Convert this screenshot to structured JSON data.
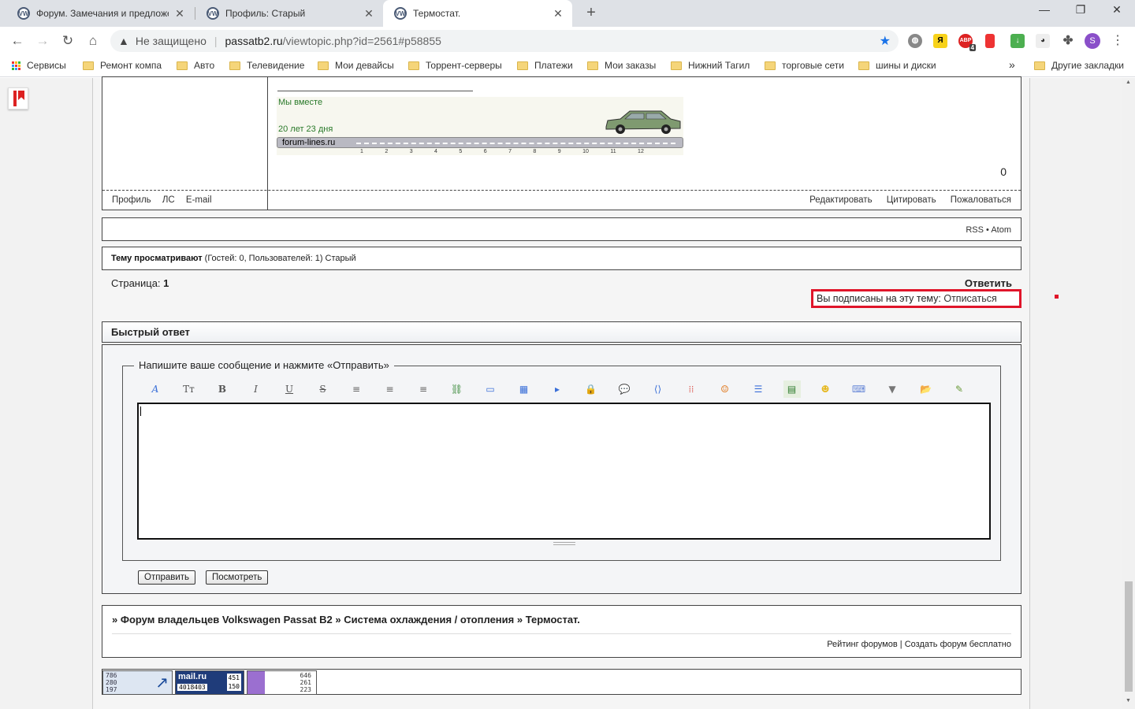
{
  "browser": {
    "tabs": [
      {
        "title": "Форум. Замечания и предложен"
      },
      {
        "title": "Профиль: Старый"
      },
      {
        "title": "Термостат."
      }
    ],
    "new_tab": "+",
    "window": {
      "minimize": "—",
      "maximize": "❐",
      "close": "✕"
    },
    "omnibox": {
      "security": "Не защищено",
      "url_host": "passatb2.ru",
      "url_path": "/viewtopic.php?id=2561#p58855"
    },
    "ext_badge": "4",
    "avatar_letter": "S",
    "bookmarks": [
      "Сервисы",
      "Ремонт компа",
      "Авто",
      "Телевидение",
      "Мои девайсы",
      "Торрент-серверы",
      "Платежи",
      "Мои заказы",
      "Нижний Тагил",
      "торговые сети",
      "шины и диски"
    ],
    "bookmarks_more": "»",
    "other_bookmarks": "Другие закладки"
  },
  "post": {
    "signature": {
      "together_label": "Мы вместе",
      "duration": "20 лет   23 дня",
      "site": "forum-lines.ru",
      "ruler": [
        "1",
        "2",
        "3",
        "4",
        "5",
        "6",
        "7",
        "8",
        "9",
        "10",
        "11",
        "12"
      ]
    },
    "count": "0",
    "user_links": [
      "Профиль",
      "ЛС",
      "E-mail"
    ],
    "actions": [
      "Редактировать",
      "Цитировать",
      "Пожаловаться"
    ]
  },
  "feeds": {
    "rss": "RSS",
    "bullet": "•",
    "atom": "Atom"
  },
  "viewers": {
    "label": "Тему просматривают",
    "detail": "(Гостей: 0, Пользователей: 1)",
    "user": "Старый"
  },
  "pager": {
    "label": "Страница:",
    "current": "1"
  },
  "reply_link": "Ответить",
  "subscription": {
    "text": "Вы подписаны на эту тему:",
    "action": "Отписаться"
  },
  "quick_reply": {
    "title": "Быстрый ответ",
    "legend": "Напишите ваше сообщение и нажмите «Отправить»",
    "tools": [
      {
        "icon": "font-color-icon",
        "glyph": "A"
      },
      {
        "icon": "font-size-icon",
        "glyph": "Tт"
      },
      {
        "icon": "bold-icon",
        "glyph": "B"
      },
      {
        "icon": "italic-icon",
        "glyph": "I"
      },
      {
        "icon": "underline-icon",
        "glyph": "U"
      },
      {
        "icon": "strikethrough-icon",
        "glyph": "S"
      },
      {
        "icon": "align-left-icon",
        "glyph": "≡"
      },
      {
        "icon": "align-center-icon",
        "glyph": "≡"
      },
      {
        "icon": "align-right-icon",
        "glyph": "≡"
      },
      {
        "icon": "link-icon",
        "glyph": "⛓"
      },
      {
        "icon": "image-icon",
        "glyph": "▭"
      },
      {
        "icon": "gallery-icon",
        "glyph": "▦"
      },
      {
        "icon": "video-icon",
        "glyph": "▸"
      },
      {
        "icon": "hide-lock-icon",
        "glyph": "🔒"
      },
      {
        "icon": "quote-bubble-icon",
        "glyph": "💬"
      },
      {
        "icon": "code-icon",
        "glyph": "⟨⟩"
      },
      {
        "icon": "table-grid-icon",
        "glyph": "⁞⁞"
      },
      {
        "icon": "smiley-special-icon",
        "glyph": "☺"
      },
      {
        "icon": "list-icon",
        "glyph": "☰"
      },
      {
        "icon": "books-icon",
        "glyph": "▤"
      },
      {
        "icon": "smiley-icon",
        "glyph": "☻"
      },
      {
        "icon": "keyboard-icon",
        "glyph": "⌨"
      },
      {
        "icon": "more-dropdown-icon",
        "glyph": "▼"
      },
      {
        "icon": "upload-folder-icon",
        "glyph": "📂"
      },
      {
        "icon": "draft-edit-icon",
        "glyph": "✎"
      }
    ],
    "submit": "Отправить",
    "preview": "Посмотреть"
  },
  "breadcrumb": {
    "sep": "»",
    "items": [
      "Форум владельцев Volkswagen Passat B2",
      "Система охлаждения / отопления",
      "Термостат."
    ]
  },
  "footer_links": {
    "rating": "Рейтинг форумов",
    "divider": "|",
    "create": "Создать форум бесплатно"
  },
  "counters": {
    "c1": [
      "786",
      "280",
      "197"
    ],
    "c2_brand": "mail.ru",
    "c2_id": "4018403",
    "c2_vals": [
      "451",
      "150"
    ],
    "c3": [
      "646",
      "261",
      "223"
    ]
  },
  "colors": {
    "highlight": "#e0152a",
    "link_green": "#2a7a2a",
    "accent": "#1a73e8"
  }
}
